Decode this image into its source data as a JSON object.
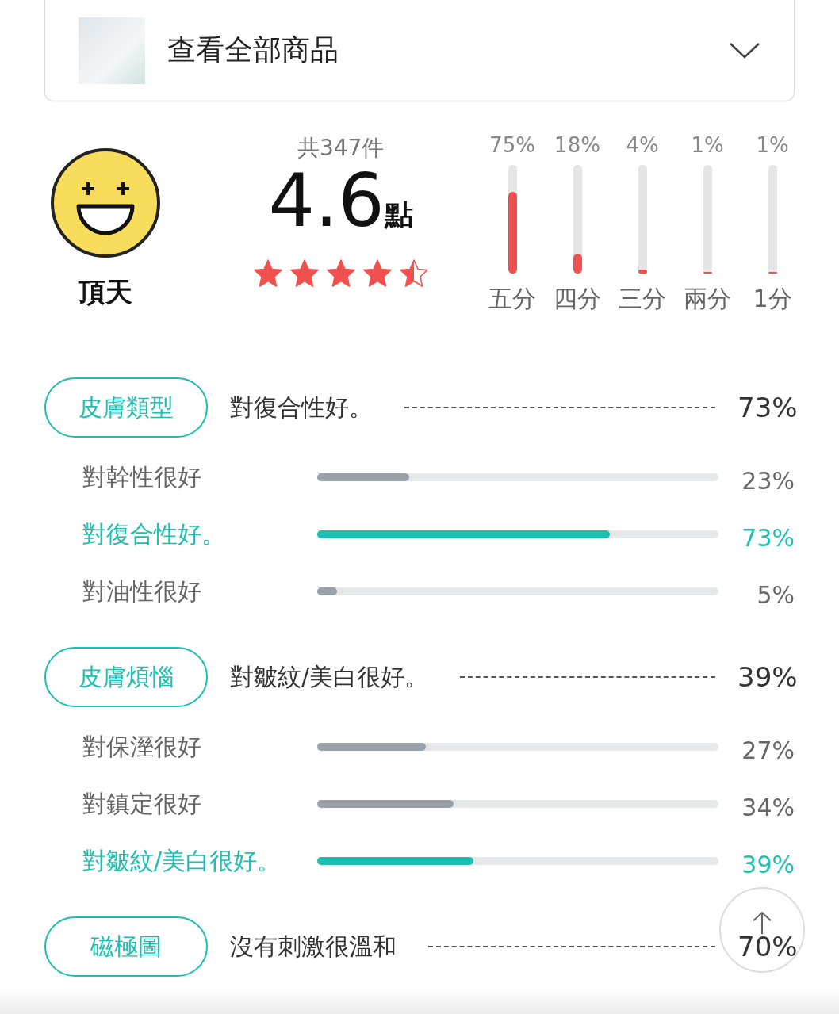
{
  "product_selector": {
    "label": "查看全部商品"
  },
  "rating": {
    "mood": "頂天",
    "count": "共347件",
    "score": "4.6",
    "unit": "點",
    "stars": 4.5
  },
  "distribution": [
    {
      "percent": "75%",
      "level": 0.75,
      "label": "五分"
    },
    {
      "percent": "18%",
      "level": 0.18,
      "label": "四分"
    },
    {
      "percent": "4%",
      "level": 0.04,
      "label": "三分"
    },
    {
      "percent": "1%",
      "level": 0.01,
      "label": "兩分"
    },
    {
      "percent": "1%",
      "level": 0.01,
      "label": "1分"
    }
  ],
  "sections": [
    {
      "tag": "皮膚類型",
      "summary": "對復合性好。",
      "summary_percent": "73%",
      "rows": [
        {
          "label": "對幹性很好",
          "level": 0.23,
          "percent": "23%",
          "selected": false
        },
        {
          "label": "對復合性好。",
          "level": 0.73,
          "percent": "73%",
          "selected": true
        },
        {
          "label": "對油性很好",
          "level": 0.05,
          "percent": "5%",
          "selected": false
        }
      ]
    },
    {
      "tag": "皮膚煩惱",
      "summary": "對皺紋/美白很好。",
      "summary_percent": "39%",
      "rows": [
        {
          "label": "對保溼很好",
          "level": 0.27,
          "percent": "27%",
          "selected": false
        },
        {
          "label": "對鎮定很好",
          "level": 0.34,
          "percent": "34%",
          "selected": false
        },
        {
          "label": "對皺紋/美白很好。",
          "level": 0.39,
          "percent": "39%",
          "selected": true
        }
      ]
    },
    {
      "tag": "磁極圖",
      "summary": "沒有刺激很溫和",
      "summary_percent": "70%"
    }
  ]
}
